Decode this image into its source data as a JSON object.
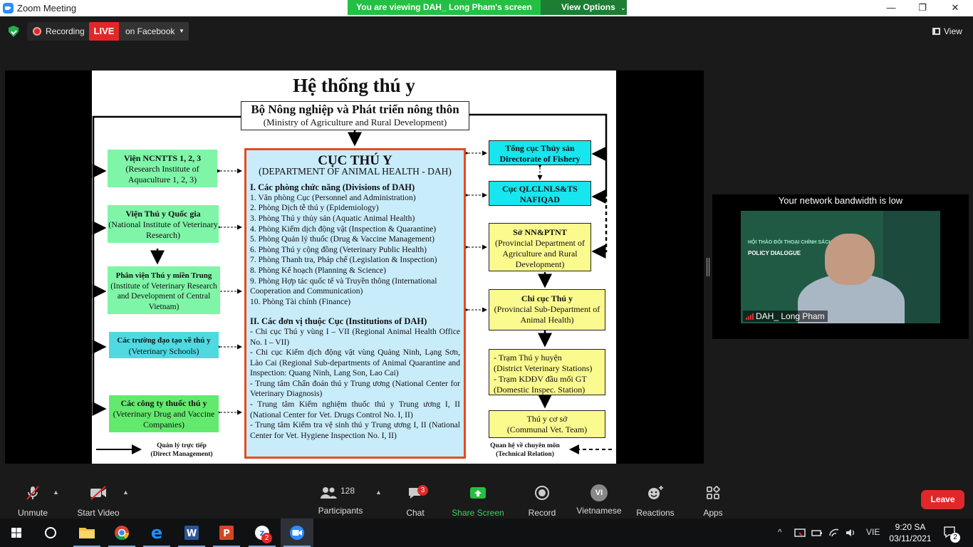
{
  "window": {
    "title": "Zoom Meeting",
    "minimize": "—",
    "maximize": "❐",
    "close": "✕"
  },
  "share_banner": {
    "text": "You are viewing DAH_ Long Pham's screen",
    "view_options": "View Options"
  },
  "meeting_bar": {
    "recording": "Recording",
    "live": "LIVE",
    "facebook": "on Facebook",
    "view": "View"
  },
  "slide": {
    "title": "Hệ thống thú y",
    "ministry": {
      "vi": "Bộ Nông nghiệp và Phát triển nông thôn",
      "en": "(Ministry of Agriculture and Rural Development)"
    },
    "left_boxes": [
      {
        "vi": "Viện NCNTTS 1, 2, 3",
        "en": "(Research Institute of Aquaculture 1, 2, 3)"
      },
      {
        "vi": "Viện Thú y Quốc gia",
        "en": "(National Institute of Veterinary Research)"
      },
      {
        "vi": "Phân viện Thú y miền Trung",
        "en": "(Institute of Veterinary Research and Development of Central Vietnam)"
      },
      {
        "vi": "Các trường đạo tạo về thú y",
        "en": "(Veterinary Schools)"
      },
      {
        "vi": "Các công ty thuốc thú y",
        "en": "(Veterinary Drug and Vaccine Companies)"
      }
    ],
    "dah": {
      "title": "CỤC THÚ Y",
      "subtitle": "(DEPARTMENT OF ANIMAL HEALTH - DAH)",
      "divisions_heading": "I. Các phòng chức năng (Divisions of DAH)",
      "divisions": [
        "1. Văn phòng Cục (Personnel and Administration)",
        "2. Phòng Dịch tễ thú y (Epidemiology)",
        "3. Phòng Thú y thủy sản (Aquatic Animal Health)",
        "4. Phòng Kiểm dịch động vật (Inspection & Quarantine)",
        "5. Phòng Quản lý thuốc (Drug & Vaccine Management)",
        "6. Phòng Thú y cộng đồng (Veterinary Public Health)",
        "7. Phòng Thanh tra, Pháp chế (Legislation & Inspection)",
        "8. Phòng Kế hoạch (Planning & Science)",
        "9. Phòng Hợp tác quốc tế và Truyền thông (International Cooperation and Communication)",
        "10. Phòng Tài chính (Finance)"
      ],
      "institutions_heading": "II. Các đơn vị thuộc Cục (Institutions of DAH)",
      "institutions": [
        "- Chi cục Thú y vùng I – VII (Regional Animal Health Office No. I – VII)",
        "- Chi cục Kiểm dịch động vật vùng Quảng Ninh, Lạng Sơn, Lào Cai (Regional Sub-departments of Animal Quarantine and Inspection: Quang Ninh, Lang Son, Lao Cai)",
        "- Trung tâm Chẩn đoán thú y Trung ương (National Center for Veterinary Diagnosis)",
        "- Trung tâm Kiểm nghiệm thuốc thú y Trung ương I, II (National Center for Vet. Drugs Control No. I, II)",
        "- Trung tâm Kiểm tra vệ sinh thú y Trung ương I, II (National Center for Vet. Hygiene Inspection No. I, II)"
      ]
    },
    "right_boxes": {
      "fishery": {
        "vi": "Tổng cục Thủy sản",
        "en": "Directorate of Fishery"
      },
      "nafiqad": {
        "vi": "Cục QLCLNLS&TS",
        "en": "NAFIQAD"
      },
      "provincial_dept": {
        "vi": "Sở NN&PTNT",
        "en": "(Provincial Department of Agriculture and Rural Development)"
      },
      "sub_dept": {
        "vi": "Chi cục Thú y",
        "en": "(Provincial Sub-Department of Animal Health)"
      },
      "district": {
        "l1": "- Trạm Thú y huyện",
        "l2": "(District Veterinary Stations)",
        "l3": "- Trạm KDĐV đầu mối GT",
        "l4": "(Domestic Inspec. Station)"
      },
      "commune": {
        "vi": "Thú y cơ sở",
        "en": "(Communal Vet. Team)"
      }
    },
    "legend": {
      "direct_vi": "Quản lý trực tiếp",
      "direct_en": "(Direct Management)",
      "technical_vi": "Quan hệ về chuyên môn",
      "technical_en": "(Technical Relation)"
    }
  },
  "video": {
    "bandwidth_notice": "Your network bandwidth is low",
    "participant_name": "DAH_ Long Pham",
    "board_line1": "HỘI THẢO ĐỐI THOẠI CHÍNH SÁCH",
    "board_line2": "POLICY DIALOGUE"
  },
  "toolbar": {
    "unmute": "Unmute",
    "start_video": "Start Video",
    "participants": "Participants",
    "participants_count": "128",
    "chat": "Chat",
    "chat_badge": "3",
    "share_screen": "Share Screen",
    "record": "Record",
    "vietnamese": "Vietnamese",
    "vi_code": "VI",
    "reactions": "Reactions",
    "apps": "Apps",
    "leave": "Leave"
  },
  "taskbar": {
    "zalo_badge": "2",
    "language": "VIE",
    "time": "9:20 SA",
    "date": "03/11/2021",
    "notifications": "2"
  },
  "colors": {
    "zoom_blue": "#2d8cff",
    "share_green": "#24c043",
    "live_red": "#e02828",
    "dah_border": "#e84a1d",
    "dah_fill": "#c9ecfb"
  }
}
